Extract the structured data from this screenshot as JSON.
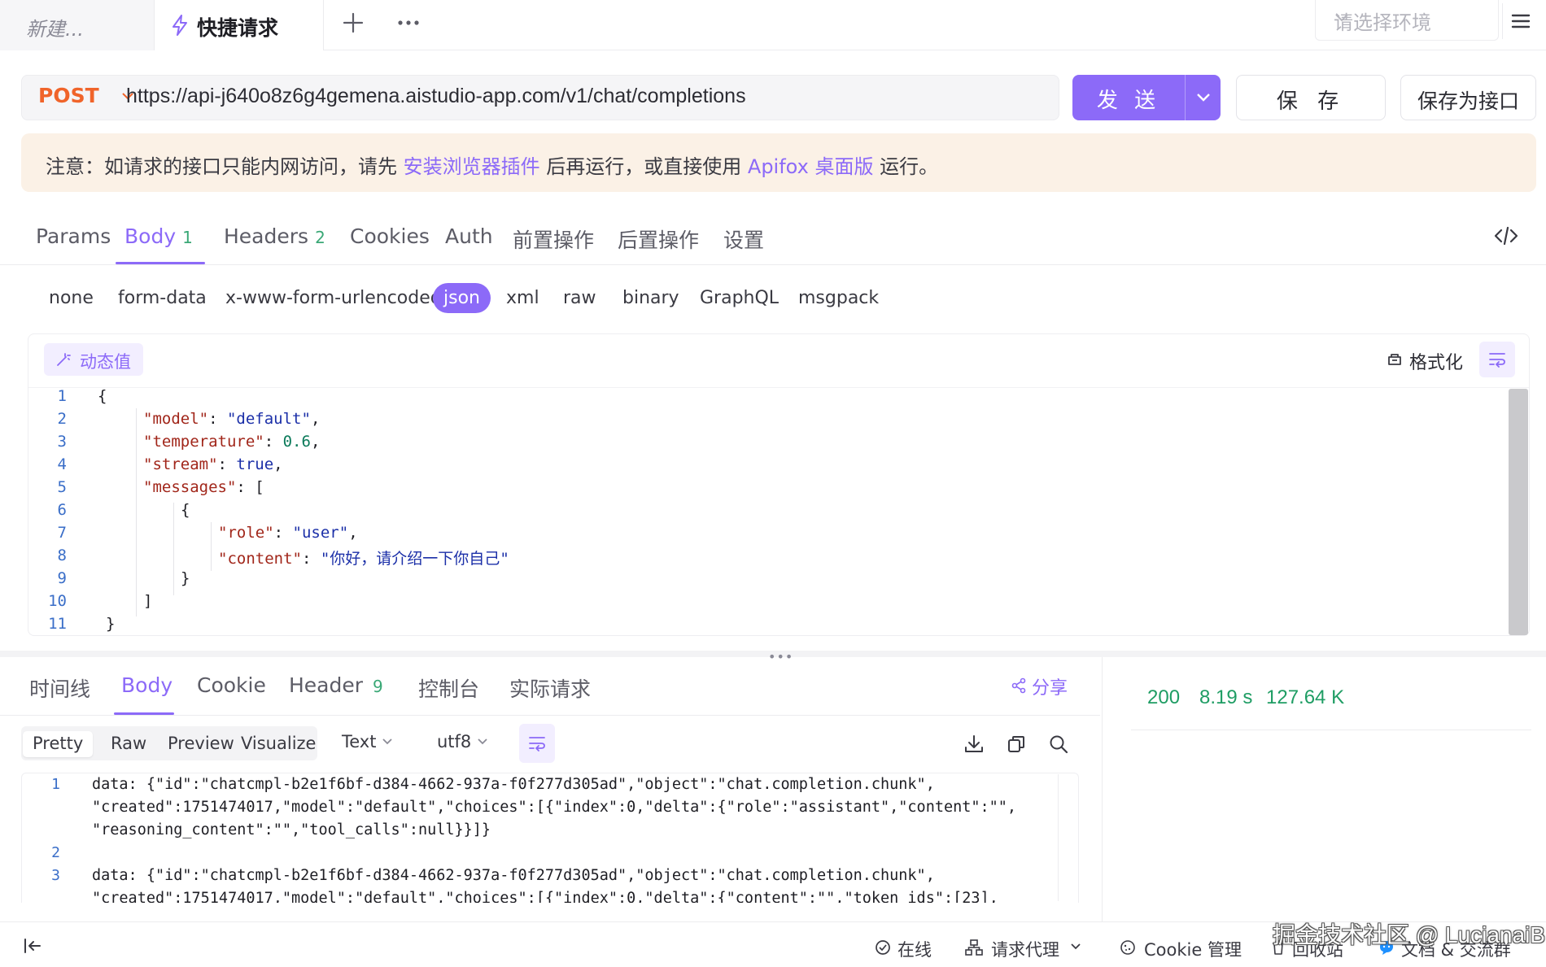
{
  "tabs": {
    "new_tab_label": "新建...",
    "active_tab_label": "快捷请求"
  },
  "environment": {
    "placeholder": "请选择环境"
  },
  "request": {
    "method": "POST",
    "url": "https://api-j640o8z6g4gemena.aistudio-app.com/v1/chat/completions",
    "send_label": "发 送",
    "save_label": "保 存",
    "save_as_label": "保存为接口"
  },
  "notice": {
    "prefix": "注意：如请求的接口只能内网访问，请先 ",
    "link1": "安装浏览器插件",
    "middle": " 后再运行，或直接使用 ",
    "link2": "Apifox 桌面版",
    "suffix": " 运行。"
  },
  "request_tabs": [
    {
      "label": "Params",
      "count": ""
    },
    {
      "label": "Body",
      "count": "1"
    },
    {
      "label": "Headers",
      "count": "2"
    },
    {
      "label": "Cookies",
      "count": ""
    },
    {
      "label": "Auth",
      "count": ""
    },
    {
      "label": "前置操作",
      "count": ""
    },
    {
      "label": "后置操作",
      "count": ""
    },
    {
      "label": "设置",
      "count": ""
    }
  ],
  "body_types": [
    "none",
    "form-data",
    "x-www-form-urlencoded",
    "json",
    "xml",
    "raw",
    "binary",
    "GraphQL",
    "msgpack"
  ],
  "editor": {
    "dynamic_value_label": "动态值",
    "format_label": "格式化",
    "line_numbers": [
      "1",
      "2",
      "3",
      "4",
      "5",
      "6",
      "7",
      "8",
      "9",
      "10",
      "11"
    ],
    "json": {
      "model": "default",
      "temperature": "0.6",
      "stream": "true",
      "role": "user",
      "content": "你好，请介绍一下你自己"
    }
  },
  "response": {
    "tabs": [
      {
        "label": "时间线",
        "count": ""
      },
      {
        "label": "Body",
        "count": ""
      },
      {
        "label": "Cookie",
        "count": ""
      },
      {
        "label": "Header",
        "count": "9"
      },
      {
        "label": "控制台",
        "count": ""
      },
      {
        "label": "实际请求",
        "count": ""
      }
    ],
    "share_label": "分享",
    "status_code": "200",
    "time": "8.19 s",
    "size": "127.64 K",
    "view_modes": [
      "Pretty",
      "Raw",
      "Preview",
      "Visualize"
    ],
    "format_select": "Text",
    "encoding_select": "utf8",
    "lines": [
      {
        "num": "1",
        "text": "data: {\"id\":\"chatcmpl-b2e1f6bf-d384-4662-937a-f0f277d305ad\",\"object\":\"chat.completion.chunk\","
      },
      {
        "num": "",
        "text": "\"created\":1751474017,\"model\":\"default\",\"choices\":[{\"index\":0,\"delta\":{\"role\":\"assistant\",\"content\":\"\","
      },
      {
        "num": "",
        "text": "\"reasoning_content\":\"\",\"tool_calls\":null}}]}"
      },
      {
        "num": "2",
        "text": ""
      },
      {
        "num": "3",
        "text": "data: {\"id\":\"chatcmpl-b2e1f6bf-d384-4662-937a-f0f277d305ad\",\"object\":\"chat.completion.chunk\","
      },
      {
        "num": "",
        "text": "\"created\":1751474017,\"model\":\"default\",\"choices\":[{\"index\":0,\"delta\":{\"content\":\"\",\"token_ids\":[23],"
      }
    ]
  },
  "footer": {
    "online": "在线",
    "proxy": "请求代理",
    "cookie_manager": "Cookie 管理",
    "recycle_bin": "回收站",
    "docs_community": "文档 & 交流群",
    "watermark": "掘金技术社区 @ LucianaiB"
  },
  "colors": {
    "accent": "#8c6af8",
    "method_post": "#f0642a",
    "status_ok": "#1f9d64",
    "notice_bg": "#fbf1e6"
  }
}
